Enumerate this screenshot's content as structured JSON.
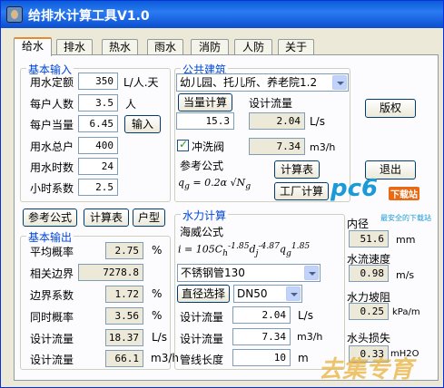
{
  "window": {
    "title": "给排水计算工具V1.0"
  },
  "tabs": [
    "给水",
    "排水",
    "热水",
    "雨水",
    "消防",
    "人防",
    "关于"
  ],
  "basic_input": {
    "title": "基本输入",
    "rows": [
      {
        "label": "用水定额",
        "value": "350",
        "unit": "L/人.天"
      },
      {
        "label": "每户人数",
        "value": "3.5",
        "unit": "人"
      },
      {
        "label": "每户当量",
        "value": "6.45",
        "unit": ""
      },
      {
        "label": "用水总户",
        "value": "400",
        "unit": ""
      },
      {
        "label": "用水时数",
        "value": "24",
        "unit": ""
      },
      {
        "label": "小时系数",
        "value": "2.5",
        "unit": ""
      }
    ],
    "input_button": "输入"
  },
  "left_buttons": {
    "formula": "参考公式",
    "calc_table": "计算表",
    "house_type": "户型"
  },
  "basic_output": {
    "title": "基本输出",
    "rows": [
      {
        "label": "平均概率",
        "value": "2.75",
        "unit": "%"
      },
      {
        "label": "相关边界",
        "value": "7278.8",
        "unit": ""
      },
      {
        "label": "边界系数",
        "value": "1.72",
        "unit": "%"
      },
      {
        "label": "同时概率",
        "value": "3.56",
        "unit": "%"
      },
      {
        "label": "设计流量",
        "value": "18.37",
        "unit": "L/s"
      },
      {
        "label": "设计流量",
        "value": "66.1",
        "unit": "m3/h"
      }
    ]
  },
  "public_building": {
    "title": "公共建筑",
    "type_select": "幼儿园、托儿所、养老院1.2",
    "equiv_button": "当量计算",
    "design_flow_label": "设计流量",
    "equiv_value": "15.3",
    "flow_ls": "2.04",
    "unit_ls": "L/s",
    "flush_valve_label": "冲洗阀",
    "flow_m3h": "7.34",
    "unit_m3h": "m3/h",
    "formula_label": "参考公式",
    "calc_table_button": "计算表",
    "factory_button": "工厂计算"
  },
  "hydraulic": {
    "title": "水力计算",
    "formula_label": "海威公式",
    "pipe_select": "不锈钢管130",
    "diameter_button": "直径选择",
    "dn_select": "DN50",
    "rows": [
      {
        "label": "设计流量",
        "value": "2.04",
        "unit": "L/s"
      },
      {
        "label": "设计流量",
        "value": "7.34",
        "unit": "m3/h"
      },
      {
        "label": "管线长度",
        "value": "10",
        "unit": "m"
      }
    ]
  },
  "right": {
    "copyright_button": "版权",
    "exit_button": "退出",
    "inner_diameter_label": "内径",
    "inner_diameter": "51.6",
    "inner_unit": "mm",
    "velocity_label": "水流速度",
    "velocity": "0.98",
    "velocity_unit": "m/s",
    "slope_label": "水力坡阻",
    "slope": "0.25",
    "slope_unit": "kPa/m",
    "headloss_label": "水头损失",
    "headloss": "0.33",
    "headloss_unit": "mH2O"
  },
  "watermarks": {
    "pc6": "pc6",
    "pc6_tag": "下载站",
    "pc6_slogan": "最安全的下载站",
    "bottom": "去集专育"
  },
  "colors": {
    "title_bar": "#0a5bd8",
    "group_title": "#0046d5",
    "accent_tab": "#e68b2c"
  }
}
